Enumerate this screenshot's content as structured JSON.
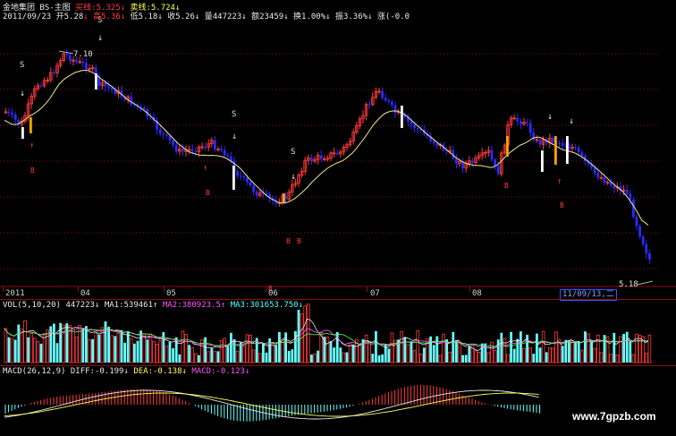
{
  "header": {
    "stock_title": "金地集团 BS-主图",
    "buy_label": "买线:5.325",
    "buy_arrow": "↓",
    "sell_label": "卖线:5.724",
    "sell_arrow": "↓"
  },
  "quote": {
    "date": "2011/09/23",
    "open": "开5.28",
    "high": "高5.36",
    "low": "低5.18",
    "close": "收5.26",
    "volume": "量447223",
    "amount": "额23459",
    "turnover": "换1.00%",
    "amplitude": "振3.36%",
    "change": "涨(-0.0"
  },
  "main_chart": {
    "high_label": "7.10",
    "low_label": "5.18",
    "sell_signal": "S",
    "buy_signal": "B",
    "x_labels": [
      "2011",
      "04",
      "05",
      "06",
      "07",
      "08"
    ],
    "selected_date": "11/09/13,二"
  },
  "volume_panel": {
    "title": "VOL(5,10,20)",
    "vol_value": "447223",
    "vol_arrow": "↓",
    "ma1": "MA1:539461",
    "ma1_arrow": "↑",
    "ma2": "MA2:380923.5",
    "ma2_arrow": "↑",
    "ma3": "MA3:301653.750",
    "ma3_arrow": "↓"
  },
  "macd_panel": {
    "title": "MACD(26,12,9)",
    "diff": "DIFF:-0.199",
    "diff_arrow": "↓",
    "dea": "DEA:-0.138",
    "dea_arrow": "↓",
    "macd": "MACD:-0.123",
    "macd_arrow": "↓"
  },
  "watermark": "www.7gpzb.com",
  "colors": {
    "up": "#ff3b3b",
    "down": "#2b2bff",
    "ma_line": "#f0e68c",
    "grid": "#8a1010",
    "volume_down": "#66ffff"
  }
}
